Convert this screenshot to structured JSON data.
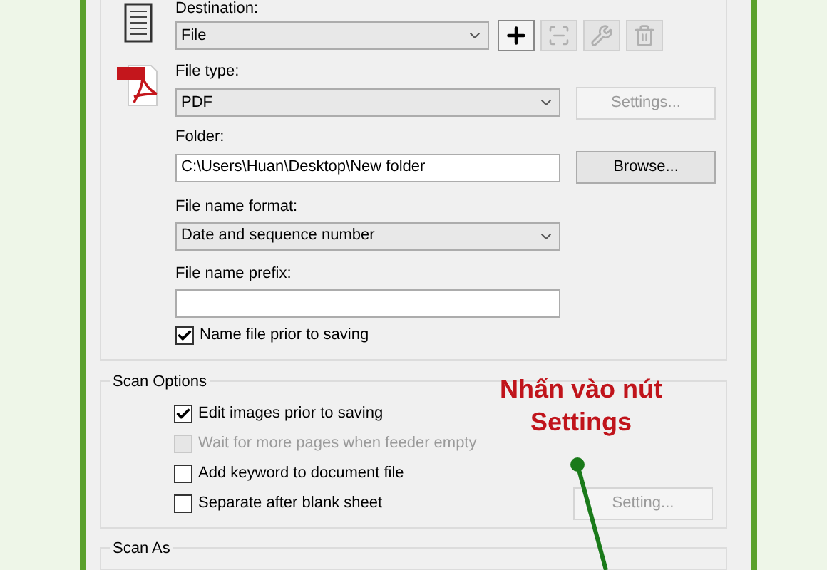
{
  "destination": {
    "label": "Destination:",
    "value": "File"
  },
  "toolbar_buttons": [
    {
      "kind": "add",
      "disabled": false
    },
    {
      "kind": "scanner",
      "disabled": true
    },
    {
      "kind": "tools",
      "disabled": true
    },
    {
      "kind": "trash",
      "disabled": true
    }
  ],
  "file_type": {
    "label": "File type:",
    "value": "PDF"
  },
  "settings_button": {
    "label": "Settings...",
    "disabled": true
  },
  "folder": {
    "label": "Folder:",
    "value": "C:\\Users\\Huan\\Desktop\\New folder"
  },
  "browse_button": {
    "label": "Browse...",
    "disabled": false
  },
  "file_name_format": {
    "label": "File name format:",
    "value": "Date and sequence number"
  },
  "file_name_prefix": {
    "label": "File name prefix:"
  },
  "name_file_prior": {
    "label": "Name file prior to saving",
    "checked": true
  },
  "scan_options": {
    "title": "Scan Options",
    "options": [
      {
        "label": "Edit images prior to saving",
        "checked": true,
        "disabled": false
      },
      {
        "label": "Wait for more pages when feeder empty",
        "checked": false,
        "disabled": true
      },
      {
        "label": "Add keyword to document file",
        "checked": false,
        "disabled": false
      },
      {
        "label": "Separate after blank sheet",
        "checked": false,
        "disabled": false
      }
    ],
    "setting_button": {
      "label": "Setting...",
      "disabled": true
    }
  },
  "scan_as": {
    "title": "Scan As"
  },
  "annotation": {
    "lines": [
      "Nhấn vào nút",
      "Settings"
    ]
  }
}
